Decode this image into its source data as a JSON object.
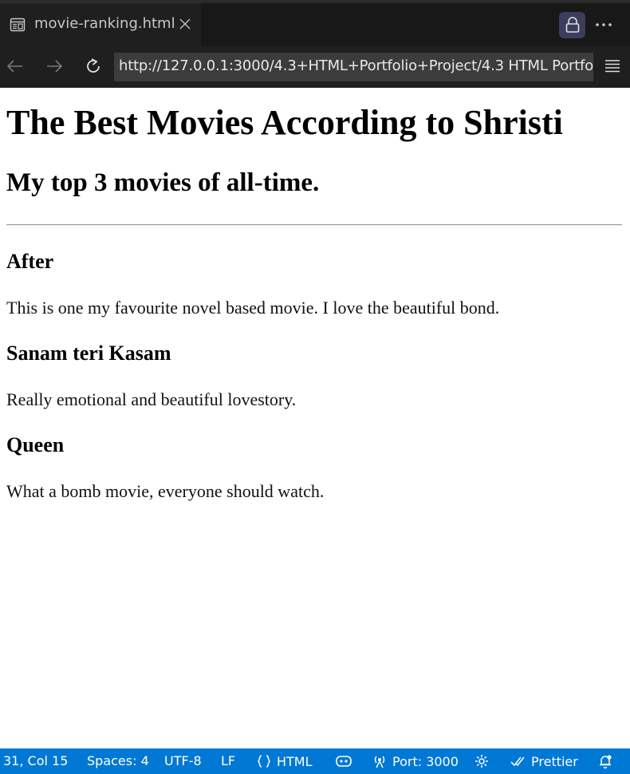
{
  "tab": {
    "title": "movie-ranking.html",
    "icon": "preview-icon"
  },
  "address_bar": {
    "url": "http://127.0.0.1:3000/4.3+HTML+Portfolio+Project/4.3 HTML Portfo"
  },
  "page": {
    "heading": "The Best Movies According to Shristi",
    "subheading": "My top 3 movies of all-time.",
    "movies": [
      {
        "title": "After",
        "description": "This is one my favourite novel based movie. I love the beautiful bond."
      },
      {
        "title": "Sanam teri Kasam",
        "description": "Really emotional and beautiful lovestory."
      },
      {
        "title": "Queen",
        "description": "What a bomb movie, everyone should watch."
      }
    ]
  },
  "status_bar": {
    "cursor": "31, Col 15",
    "spaces": "Spaces: 4",
    "encoding": "UTF-8",
    "eol": "LF",
    "language": "HTML",
    "port": "Port: 3000",
    "prettier": "Prettier"
  },
  "colors": {
    "status_bar_bg": "#0078d4",
    "chrome_bg": "#1f1f1f",
    "url_bg": "#3c3c3c"
  }
}
